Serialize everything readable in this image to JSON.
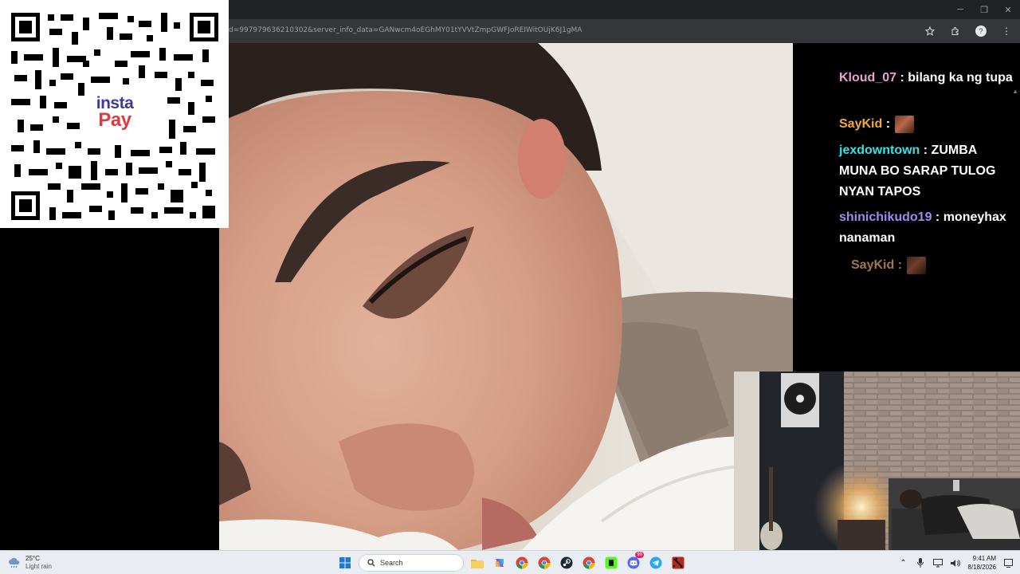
{
  "browser": {
    "url": "d=997979636210302&server_info_data=GANwcm4oEGhMY01tYVVtZmpGWFJoREIWitOUjK6J1gMA",
    "window_controls": [
      "─",
      "❐",
      "✕"
    ]
  },
  "qr": {
    "brand_line1": "insta",
    "brand_line2": "Pay"
  },
  "chat": {
    "messages": [
      {
        "user": "Kloud_07",
        "text": "bilang ka ng tupa",
        "color": "#e9a2d5"
      },
      {
        "user": "SayKid",
        "text": "",
        "emote": "face-emote",
        "color": "#f2a93b"
      },
      {
        "user": "jexdowntown",
        "text": "ZUMBA MUNA BO SARAP TULOG NYAN TAPOS",
        "color": "#36e3e6"
      },
      {
        "user": "shinichikudo19",
        "text": "moneyhax nanaman",
        "color": "#9d8cf2"
      },
      {
        "user": "SayKid",
        "text": "",
        "emote": "face-emote",
        "color": "#a0774a"
      }
    ]
  },
  "taskbar": {
    "weather_temp": "25°C",
    "weather_desc": "Light rain",
    "search_placeholder": "Search",
    "time": "9:41 AM",
    "date": "8/18/2026",
    "discord_badge": "99"
  },
  "colors": {
    "chrome_dark": "#202124",
    "address_bar": "#35363a",
    "instapay_blue": "#3d3b9e",
    "instapay_red": "#e03a3e"
  }
}
